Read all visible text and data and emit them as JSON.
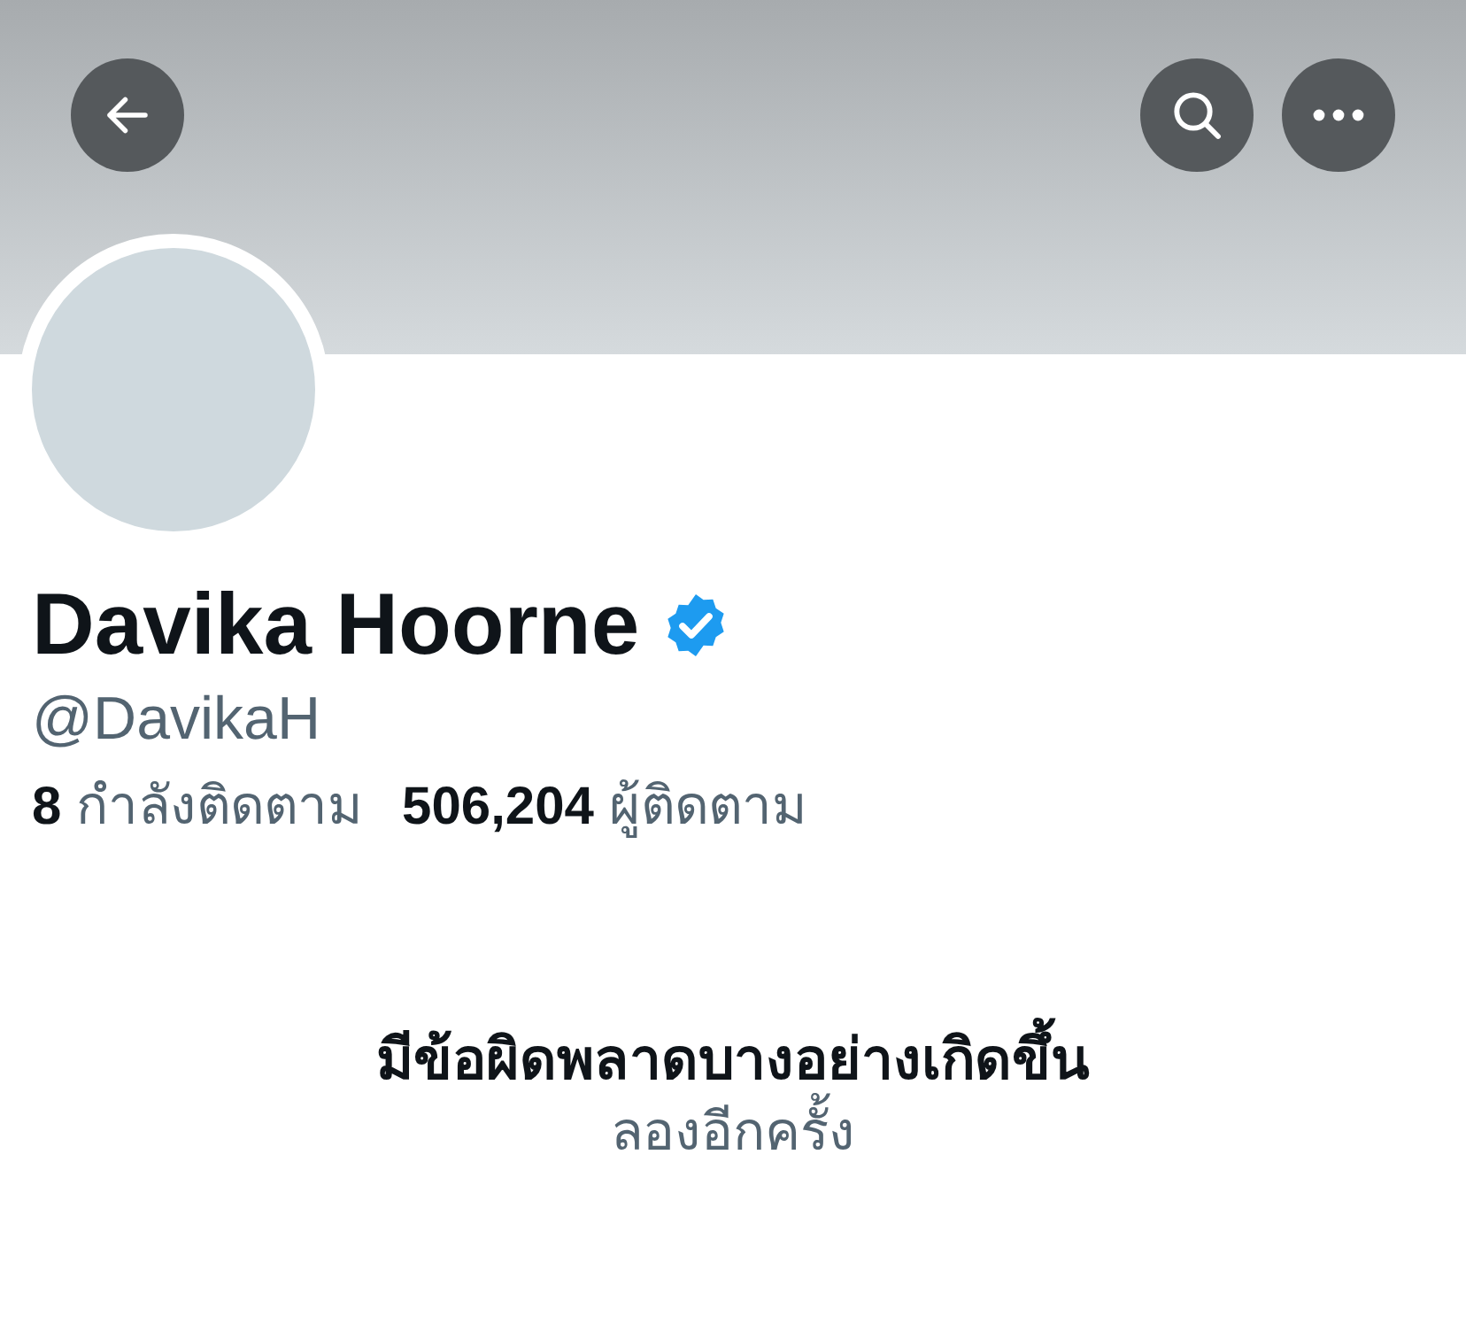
{
  "header": {
    "buttons": [
      {
        "kind": "back"
      },
      {
        "kind": "search"
      },
      {
        "kind": "more"
      }
    ]
  },
  "profile": {
    "name": "Davika Hoorne",
    "verified": true,
    "handle": "@DavikaH",
    "stats": [
      {
        "count": "8",
        "label": "กำลังติดตาม"
      },
      {
        "count": "506,204",
        "label": "ผู้ติดตาม"
      }
    ]
  },
  "error": {
    "message": "มีข้อผิดพลาดบางอย่างเกิดขึ้น",
    "retry": "ลองอีกครั้ง"
  }
}
